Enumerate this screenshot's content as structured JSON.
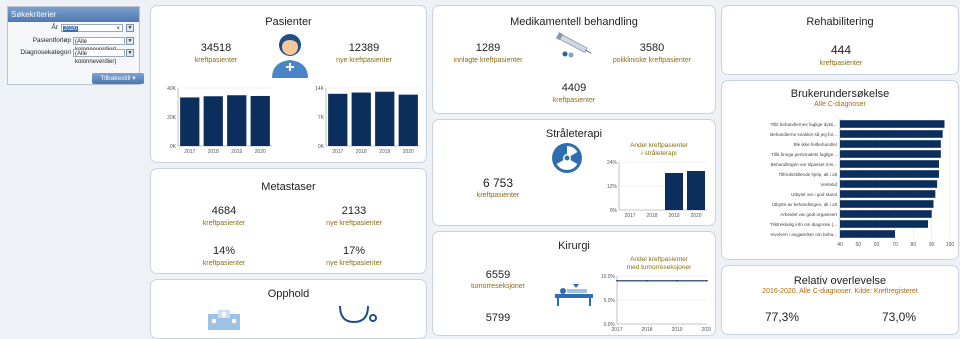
{
  "search": {
    "title": "Søkekriterier",
    "year_label": "År",
    "year_value": "2020",
    "clear_icon": "×",
    "pathway_label": "Pasientforløp",
    "pathway_value": "(Alle kolonneverdier)",
    "diag_label": "Diagnosekategori",
    "diag_value": "(Alle kolonneverdier)",
    "reset_label": "Tilbakestill ▾"
  },
  "pasienter": {
    "title": "Pasienter",
    "left_value": "34518",
    "left_label": "kreftpasienter",
    "right_value": "12389",
    "right_label": "nye kreftpasienter"
  },
  "metastaser": {
    "title": "Metastaser",
    "a_value": "4684",
    "a_label": "kreftpasienter",
    "b_value": "2133",
    "b_label": "nye kreftpasienter",
    "c_value": "14%",
    "c_label": "kreftpasienter",
    "d_value": "17%",
    "d_label": "nye kreftpasienter"
  },
  "opphold": {
    "title": "Opphold"
  },
  "medikamentell": {
    "title": "Medikamentell behandling",
    "a_value": "1289",
    "a_label": "innlagte kreftpasienter",
    "b_value": "3580",
    "b_label": "polikliniske kreftpasienter",
    "c_value": "4409",
    "c_label": "kreftpasienter"
  },
  "straaleterapi": {
    "title": "Stråleterapi",
    "value": "6 753",
    "label": "kreftpasienter"
  },
  "kirurgi": {
    "title": "Kirurgi",
    "a_value": "6559",
    "a_label": "tumorreseksjoner",
    "b_value": "5799"
  },
  "rehabilitering": {
    "title": "Rehabilitering",
    "value": "444",
    "label": "kreftpasienter"
  },
  "brukerunders": {
    "title": "Brukerundersøkelse",
    "subtitle": "Alle C-diagnoser"
  },
  "overlevelse": {
    "title": "Relativ overlevelse",
    "subtitle": "2016-2020. Alle C-diagnoser. Kilde: Kreftregisteret",
    "a_value": "77,3%",
    "b_value": "73,0%"
  },
  "chart_data": [
    {
      "type": "bar",
      "categories": [
        "2017",
        "2018",
        "2019",
        "2020"
      ],
      "values": [
        33500,
        34300,
        35000,
        34500
      ],
      "yticks": [
        "0K",
        "20K",
        "40K"
      ],
      "ylim": [
        0,
        40000
      ],
      "title": "",
      "xlabel": "",
      "ylabel": ""
    },
    {
      "type": "bar",
      "categories": [
        "2017",
        "2018",
        "2019",
        "2020"
      ],
      "values": [
        12600,
        12900,
        13100,
        12400
      ],
      "yticks": [
        "0K",
        "7K",
        "14K"
      ],
      "ylim": [
        0,
        14000
      ],
      "title": "",
      "xlabel": "",
      "ylabel": ""
    },
    {
      "type": "bar",
      "title": "Andel kreftpasienter i stråleterapi",
      "categories": [
        "2017",
        "2018",
        "2019",
        "2020"
      ],
      "values": [
        null,
        null,
        18.5,
        19.5
      ],
      "yticks": [
        "0%",
        "12%",
        "24%"
      ],
      "ylim": [
        0,
        24
      ],
      "xlabel": "",
      "ylabel": ""
    },
    {
      "type": "line",
      "title": "Andel kreftpasienter med tumorreseksjoner",
      "categories": [
        "2017",
        "2018",
        "2019",
        "2020"
      ],
      "values": [
        9.0,
        9.0,
        9.0,
        9.0
      ],
      "yticks": [
        "0.0%",
        "5.0%",
        "10.0%"
      ],
      "ylim": [
        0,
        10
      ],
      "xlabel": "",
      "ylabel": ""
    },
    {
      "type": "bar",
      "orientation": "horizontal",
      "title": "Brukerundersøkelse",
      "categories": [
        "Tillit behandlernes faglige dykti...",
        "Behandlerne snakket så jeg for...",
        "Ble ikke feilbehandlet",
        "Tillit ånnga personalets faglige...",
        "Behandlingen var tilpasset min...",
        "Tilfredsstillende hjelp, alt i alt",
        "Ventetid",
        "Utbytet var i god stand",
        "Utbytte av behandlingen, alt i alt",
        "Arbeidet var godt organisert",
        "Tilstrekkelig info om diagnose (...",
        "Involvert i avgjørelser om beha..."
      ],
      "values": [
        97,
        96,
        95,
        95,
        94,
        94,
        93,
        92,
        91,
        90,
        88,
        70
      ],
      "xticks": [
        "40",
        "50",
        "60",
        "70",
        "80",
        "90",
        "100"
      ],
      "xlim": [
        40,
        100
      ],
      "xlabel": "",
      "ylabel": ""
    }
  ]
}
